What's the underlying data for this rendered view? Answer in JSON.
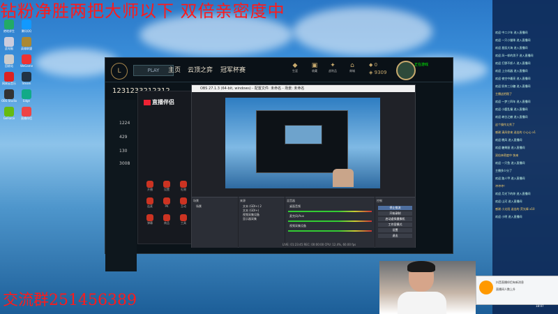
{
  "overlay": {
    "title": "钻粉净胜两把大师以下    双倍亲密度中",
    "qq_group": "交流群251456389"
  },
  "desktop_icons": [
    {
      "name": "app-icon-1",
      "label": "绝地求生",
      "color": "#2a6"
    },
    {
      "name": "app-icon-2",
      "label": "腾讯QQ",
      "color": "#19f"
    },
    {
      "name": "app-icon-3",
      "label": "此电脑",
      "color": "#ccd"
    },
    {
      "name": "app-icon-4",
      "label": "英雄联盟",
      "color": "#a83"
    },
    {
      "name": "app-icon-5",
      "label": "回收站",
      "color": "#ccc"
    },
    {
      "name": "app-icon-6",
      "label": "WeGame",
      "color": "#e33"
    },
    {
      "name": "app-icon-7",
      "label": "网易云音乐",
      "color": "#d22"
    },
    {
      "name": "app-icon-8",
      "label": "Steam",
      "color": "#234"
    },
    {
      "name": "app-icon-9",
      "label": "OBS Studio",
      "color": "#333"
    },
    {
      "name": "app-icon-10",
      "label": "Edge",
      "color": "#1a8"
    },
    {
      "name": "app-icon-11",
      "label": "GeForce",
      "color": "#6b1"
    },
    {
      "name": "app-icon-12",
      "label": "直播伴侣",
      "color": "#e44"
    }
  ],
  "lol": {
    "logo": "L",
    "play_button": "PLAY",
    "nav": [
      "主页",
      "云顶之弈",
      "冠军杯赛"
    ],
    "top_icons": [
      {
        "glyph": "◆",
        "label": "生涯"
      },
      {
        "glyph": "▣",
        "label": "收藏"
      },
      {
        "glyph": "✦",
        "label": "战利品"
      },
      {
        "glyph": "⌂",
        "label": "商城"
      }
    ],
    "currency": {
      "rp": "0",
      "be": "9309"
    },
    "status": "正在游戏",
    "profile_name": "1231233212312",
    "sidebar": [
      "1224",
      "429",
      "130",
      "3008"
    ]
  },
  "helper": {
    "app_name": "直播伴侣",
    "tiles": [
      "开播",
      "设置",
      "礼物",
      "连麦",
      "PK",
      "互动",
      "弹幕",
      "商品",
      "工具"
    ]
  },
  "obs": {
    "title": "OBS 27.1.3 (64-bit, windows) - 配置文件: 未命名 - 场景: 未命名",
    "docks": {
      "scenes": "场景",
      "sources": "来源",
      "mixer": "混音器",
      "transitions": "场景过渡",
      "controls": "控制"
    },
    "scene_list": [
      "场景"
    ],
    "source_list": [
      "文本 (GDI+) 2",
      "文本 (GDI+)",
      "视频采集设备",
      "显示器采集"
    ],
    "mixer_channels": [
      "桌面音频",
      "麦克风/Aux",
      "视频采集设备"
    ],
    "controls": [
      {
        "label": "停止推流",
        "active": true
      },
      {
        "label": "开始录制",
        "active": false
      },
      {
        "label": "启动虚拟摄像机",
        "active": false
      },
      {
        "label": "工作室模式",
        "active": false
      },
      {
        "label": "设置",
        "active": false
      },
      {
        "label": "退出",
        "active": false
      }
    ],
    "status_bar": "LIVE: 01:23:45  REC: 00:00:00  CPU: 12.4%, 60.00 fps"
  },
  "chat": [
    {
      "text": "欢迎 中二少年 进入直播间",
      "hl": false
    },
    {
      "text": "欢迎 一只小猫咪 进入直播间",
      "hl": false
    },
    {
      "text": "欢迎 星辰大海 进入直播间",
      "hl": false
    },
    {
      "text": "欢迎 风一样的男子 进入直播间",
      "hl": false
    },
    {
      "text": "欢迎 打野不抓人 进入直播间",
      "hl": false
    },
    {
      "text": "欢迎 上分机器 进入直播间",
      "hl": false
    },
    {
      "text": "欢迎 夜空中最亮 进入直播间",
      "hl": false
    },
    {
      "text": "欢迎 奶茶三分糖 进入直播间",
      "hl": false
    },
    {
      "text": "主播这把稳了",
      "hl": true
    },
    {
      "text": "欢迎 一梦三四年 进入直播间",
      "hl": false
    },
    {
      "text": "欢迎 小鹿乱撞 进入直播间",
      "hl": false
    },
    {
      "text": "欢迎 峡谷之巅 进入直播间",
      "hl": false
    },
    {
      "text": "这个操作太秀了",
      "hl": true
    },
    {
      "text": "感谢 清风徐来 送出的 小心心 x1",
      "hl": true
    },
    {
      "text": "欢迎 晚风 进入直播间",
      "hl": false
    },
    {
      "text": "欢迎 糖果屋 进入直播间",
      "hl": false
    },
    {
      "text": "双倍亲密度中 快来",
      "hl": true
    },
    {
      "text": "欢迎 一只鱼 进入直播间",
      "hl": false
    },
    {
      "text": "主播多少分了",
      "hl": false
    },
    {
      "text": "欢迎 路人甲 进入直播间",
      "hl": false
    },
    {
      "text": "冲冲冲！",
      "hl": true
    },
    {
      "text": "欢迎 月光下的你 进入直播间",
      "hl": false
    },
    {
      "text": "欢迎 山河 进入直播间",
      "hl": false
    },
    {
      "text": "感谢 小太阳 送出的 荧光棒 x10",
      "hl": true
    },
    {
      "text": "欢迎 小明 进入直播间",
      "hl": false
    }
  ],
  "notification": {
    "title": "抖音直播伴侣有新消息",
    "body": "直播间人数上升"
  },
  "clock": "18:07"
}
